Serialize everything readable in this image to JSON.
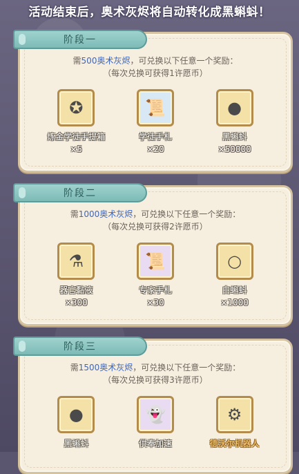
{
  "banner": "活动结束后，奥术灰烬将自动转化成黑蝌蚪！",
  "stages": [
    {
      "title": "阶段一",
      "desc_prefix": "需",
      "desc_highlight": "500奥术灰烬",
      "desc_suffix": "，可兑换以下任意一个奖励：",
      "desc2": "（每次兑换可获得1许愿币）",
      "rewards": [
        {
          "name": "炼金学徒手提箱",
          "qty": "×5",
          "icon": "briefcase-icon",
          "glyph": "✪"
        },
        {
          "name": "学徒手札",
          "qty": "×20",
          "icon": "scroll-icon",
          "glyph": "📜"
        },
        {
          "name": "黑蝌蚪",
          "qty": "×50000",
          "icon": "black-tadpole-icon",
          "glyph": "●"
        }
      ]
    },
    {
      "title": "阶段二",
      "desc_prefix": "需",
      "desc_highlight": "1000奥术灰烬",
      "desc_suffix": "，可兑换以下任意一个奖励：",
      "desc2": "（每次兑换可获得2许愿币）",
      "rewards": [
        {
          "name": "器官黏液",
          "qty": "×300",
          "icon": "slime-vial-icon",
          "glyph": "⚗"
        },
        {
          "name": "专家手札",
          "qty": "×30",
          "icon": "expert-scroll-icon",
          "glyph": "📜"
        },
        {
          "name": "白蝌蚪",
          "qty": "×1000",
          "icon": "white-tadpole-icon",
          "glyph": "○"
        }
      ]
    },
    {
      "title": "阶段三",
      "desc_prefix": "需",
      "desc_highlight": "1500奥术灰烬",
      "desc_suffix": "，可兑换以下任意一个奖励：",
      "desc2": "（每次兑换可获得3许愿币）",
      "rewards": [
        {
          "name": "黑蝌蚪",
          "qty": "",
          "icon": "black-tadpole-icon",
          "glyph": "●"
        },
        {
          "name": "供奉加速",
          "qty": "",
          "icon": "ghost-speedup-icon",
          "glyph": "👻"
        },
        {
          "name": "德沃尔机器人",
          "qty": "",
          "icon": "robot-icon",
          "glyph": "⚙",
          "gold": true
        }
      ]
    }
  ]
}
